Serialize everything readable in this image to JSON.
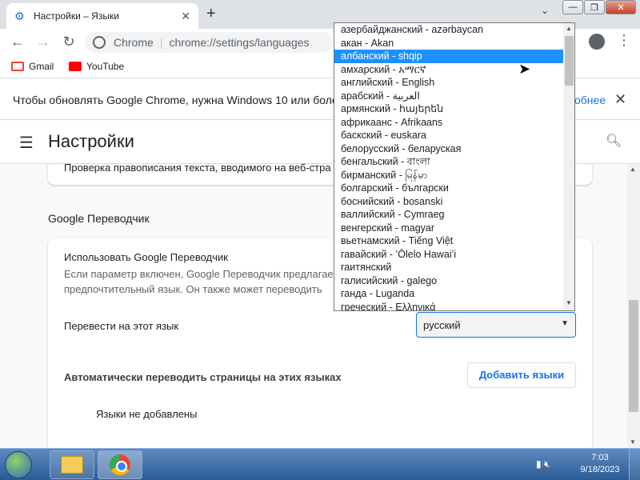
{
  "tab": {
    "title": "Настройки – Языки",
    "close": "✕",
    "new_tab": "+"
  },
  "window_controls": {
    "dropdown": "⌄",
    "minimize": "—",
    "maximize": "❐",
    "close": "✕"
  },
  "toolbar": {
    "back": "←",
    "forward": "→",
    "reload": "↻",
    "menu": "⋮"
  },
  "omnibox": {
    "site": "Chrome",
    "url": "chrome://settings/languages"
  },
  "bookmarks": [
    {
      "label": "Gmail"
    },
    {
      "label": "YouTube"
    }
  ],
  "infobar": {
    "message": "Чтобы обновлять Google Chrome, нужна Windows 10 или более по",
    "more": "обнее",
    "close": "✕"
  },
  "settings": {
    "title": "Настройки"
  },
  "content": {
    "spellcheck_text": "Проверка правописания текста, вводимого на веб-стра",
    "section_title": "Google Переводчик",
    "use_translate_title": "Использовать Google Переводчик",
    "use_translate_desc": "Если параметр включен, Google Переводчик предлагае предпочтительный язык. Он также может переводить",
    "translate_to_label": "Перевести на этот язык",
    "translate_to_value": "русский",
    "auto_translate_label": "Автоматически переводить страницы на этих языках",
    "add_languages_button": "Добавить языки",
    "no_languages": "Языки не добавлены"
  },
  "dropdown": {
    "selected_index": 2,
    "options": [
      "азербайджанский - azərbaycan",
      "акан - Akan",
      "албанский - shqip",
      "амхарский - አማርኛ",
      "английский - English",
      "арабский - العربية",
      "армянский - հայերեն",
      "африкаанс - Afrikaans",
      "баскский - euskara",
      "белорусский - беларуская",
      "бенгальский - বাংলা",
      "бирманский - မြန်မာ",
      "болгарский - български",
      "боснийский - bosanski",
      "валлийский - Cymraeg",
      "венгерский - magyar",
      "вьетнамский - Tiếng Việt",
      "гавайский - ʻŌlelo Hawaiʻi",
      "гаитянский",
      "галисийский - galego",
      "ганда - Luganda",
      "греческий - Ελληνικά"
    ]
  },
  "taskbar": {
    "time": "7:03",
    "date": "9/18/2023"
  }
}
